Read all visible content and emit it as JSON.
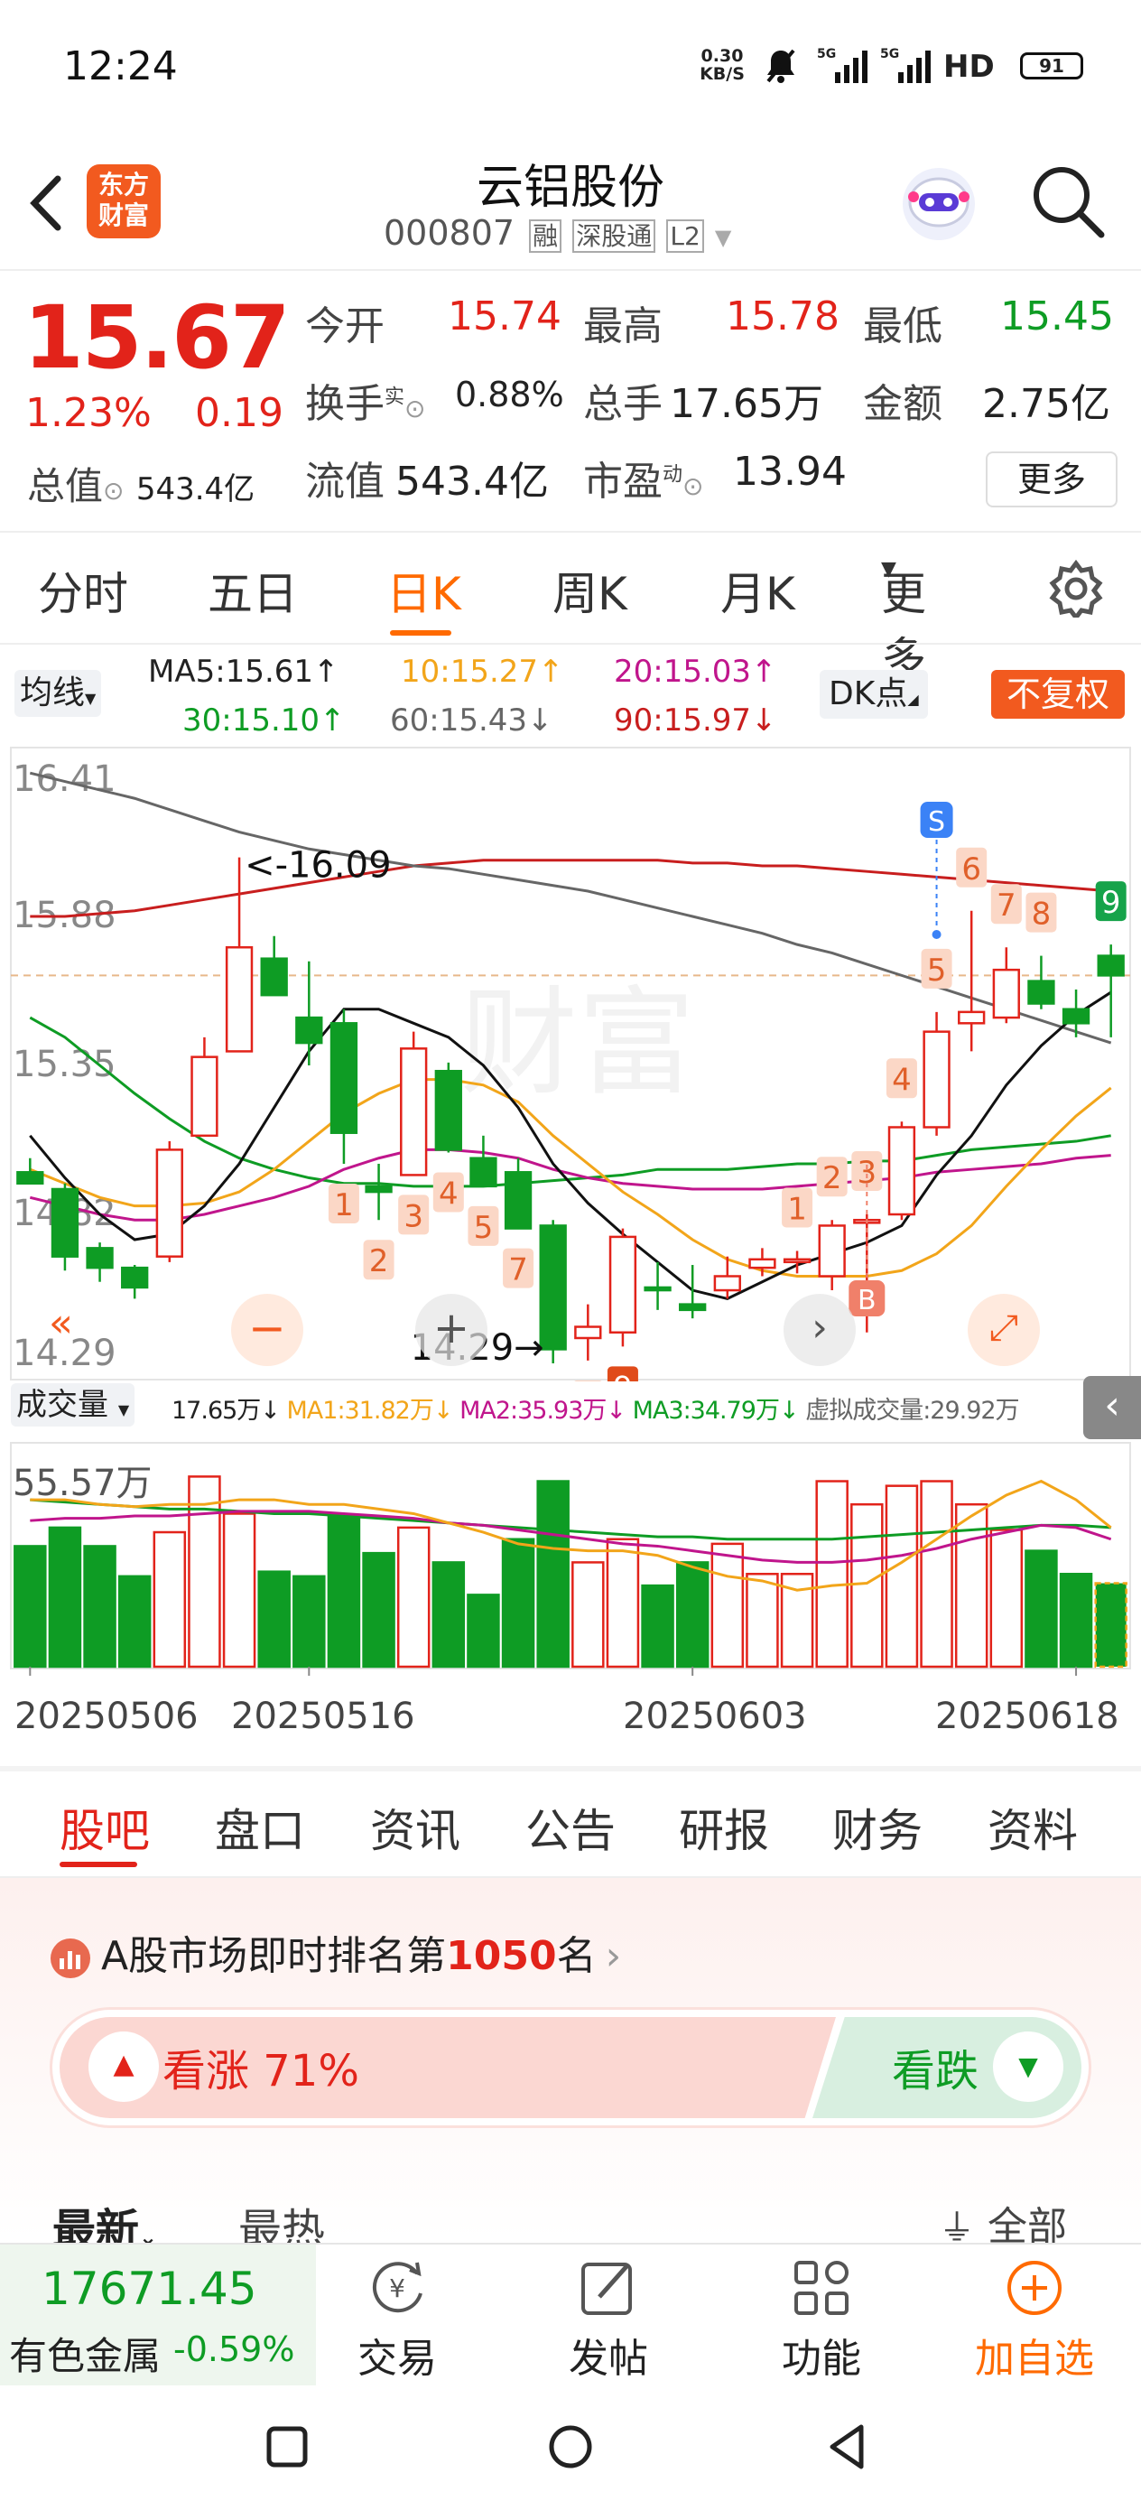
{
  "status": {
    "time": "12:24",
    "net_speed_top": "0.30",
    "net_speed_bottom": "KB/S",
    "sig1": "5G",
    "sig2": "5G",
    "hd": "HD",
    "battery": "91"
  },
  "header": {
    "logo_top": "东方",
    "logo_bottom": "财富",
    "title": "云铝股份",
    "code": "000807",
    "tags": [
      "融",
      "深股通",
      "L2"
    ]
  },
  "quote": {
    "price": "15.67",
    "pct": "1.23%",
    "chg": "0.19",
    "fields": {
      "open_l": "今开",
      "open_v": "15.74",
      "high_l": "最高",
      "high_v": "15.78",
      "low_l": "最低",
      "low_v": "15.45",
      "turn_l": "换手",
      "turn_sup": "实",
      "turn_v": "0.88%",
      "vol_l": "总手",
      "vol_v": "17.65万",
      "amt_l": "金额",
      "amt_v": "2.75亿",
      "mcap_l": "总值",
      "mcap_v": "543.4亿",
      "float_l": "流值",
      "float_v": "543.4亿",
      "pe_l": "市盈",
      "pe_sup": "动",
      "pe_v": "13.94"
    },
    "more": "更多"
  },
  "period_tabs": [
    "分时",
    "五日",
    "日K",
    "周K",
    "月K",
    "更多"
  ],
  "ma": {
    "selector": "均线",
    "ma5": "MA5:15.61↑",
    "ma10": "10:15.27↑",
    "ma20": "20:15.03↑",
    "ma30": "30:15.10↑",
    "ma60": "60:15.43↓",
    "ma90": "90:15.97↓",
    "dk": "DK点",
    "fq": "不复权"
  },
  "chart": {
    "y_labels": [
      "16.41",
      "15.88",
      "15.35",
      "14.82",
      "14.29"
    ],
    "hi_label": "<-16.09",
    "lo_label": "14.29→",
    "s_mark": "S",
    "b_mark": "B"
  },
  "volume": {
    "selector": "成交量",
    "vol": "17.65万↓",
    "ma1": "MA1:31.82万↓",
    "ma2": "MA2:35.93万↓",
    "ma3": "MA3:34.79万↓",
    "virtual": "虚拟成交量:29.92万",
    "y_label": "55.57万",
    "dates": [
      "20250506",
      "20250516",
      "20250603",
      "20250618"
    ]
  },
  "bottom_tabs": [
    "股吧",
    "盘口",
    "资讯",
    "公告",
    "研报",
    "财务",
    "资料"
  ],
  "rank": {
    "prefix": "A股市场即时排名第",
    "num": "1050",
    "suffix": "名"
  },
  "sentiment": {
    "up": "看涨 71%",
    "down": "看跌"
  },
  "feed": {
    "latest": "最新",
    "hot": "最热",
    "all": "全部"
  },
  "bottombar": {
    "index_value": "17671.45",
    "index_name": "有色金属",
    "index_pct": "-0.59%",
    "trade": "交易",
    "post": "发帖",
    "func": "功能",
    "add": "加自选"
  },
  "colors": {
    "red": "#e2231a",
    "green": "#0e9c24",
    "accent": "#ff6a00"
  },
  "chart_data": {
    "type": "candlestick",
    "candles": [
      {
        "o": 14.97,
        "h": 15.02,
        "l": 14.93,
        "c": 14.93
      },
      {
        "o": 14.91,
        "h": 14.93,
        "l": 14.62,
        "c": 14.67
      },
      {
        "o": 14.7,
        "h": 14.72,
        "l": 14.58,
        "c": 14.63
      },
      {
        "o": 14.63,
        "h": 14.64,
        "l": 14.52,
        "c": 14.56
      },
      {
        "o": 14.67,
        "h": 15.08,
        "l": 14.65,
        "c": 15.05
      },
      {
        "o": 15.1,
        "h": 15.45,
        "l": 15.1,
        "c": 15.38
      },
      {
        "o": 15.4,
        "h": 16.09,
        "l": 15.4,
        "c": 15.77
      },
      {
        "o": 15.73,
        "h": 15.81,
        "l": 15.6,
        "c": 15.6
      },
      {
        "o": 15.52,
        "h": 15.72,
        "l": 15.35,
        "c": 15.43
      },
      {
        "o": 15.5,
        "h": 15.55,
        "l": 15.0,
        "c": 15.11
      },
      {
        "o": 14.92,
        "h": 15.0,
        "l": 14.8,
        "c": 14.9
      },
      {
        "o": 14.96,
        "h": 15.47,
        "l": 14.96,
        "c": 15.41
      },
      {
        "o": 15.33,
        "h": 15.36,
        "l": 15.04,
        "c": 15.05
      },
      {
        "o": 15.02,
        "h": 15.1,
        "l": 14.92,
        "c": 14.92
      },
      {
        "o": 14.97,
        "h": 15.02,
        "l": 14.77,
        "c": 14.77
      },
      {
        "o": 14.78,
        "h": 14.8,
        "l": 14.29,
        "c": 14.34
      },
      {
        "o": 14.38,
        "h": 14.5,
        "l": 14.3,
        "c": 14.42
      },
      {
        "o": 14.4,
        "h": 14.77,
        "l": 14.35,
        "c": 14.74
      },
      {
        "o": 14.56,
        "h": 14.65,
        "l": 14.48,
        "c": 14.55
      },
      {
        "o": 14.5,
        "h": 14.64,
        "l": 14.45,
        "c": 14.48
      },
      {
        "o": 14.55,
        "h": 14.67,
        "l": 14.52,
        "c": 14.6
      },
      {
        "o": 14.63,
        "h": 14.7,
        "l": 14.6,
        "c": 14.66
      },
      {
        "o": 14.66,
        "h": 14.69,
        "l": 14.61,
        "c": 14.66
      },
      {
        "o": 14.6,
        "h": 14.8,
        "l": 14.55,
        "c": 14.78
      },
      {
        "o": 14.79,
        "h": 14.82,
        "l": 14.4,
        "c": 14.8
      },
      {
        "o": 14.82,
        "h": 15.15,
        "l": 14.8,
        "c": 15.13
      },
      {
        "o": 15.13,
        "h": 15.54,
        "l": 15.1,
        "c": 15.47
      },
      {
        "o": 15.5,
        "h": 15.9,
        "l": 15.4,
        "c": 15.54
      },
      {
        "o": 15.52,
        "h": 15.77,
        "l": 15.5,
        "c": 15.69
      },
      {
        "o": 15.65,
        "h": 15.74,
        "l": 15.55,
        "c": 15.57
      },
      {
        "o": 15.55,
        "h": 15.62,
        "l": 15.45,
        "c": 15.5
      },
      {
        "o": 15.74,
        "h": 15.78,
        "l": 15.45,
        "c": 15.67
      }
    ],
    "volume": [
      52,
      60,
      52,
      39,
      58,
      82,
      66,
      41,
      39,
      65,
      49,
      60,
      45,
      31,
      55,
      80,
      45,
      55,
      35,
      45,
      53,
      40,
      40,
      80,
      70,
      78,
      80,
      70,
      59,
      50,
      40,
      36
    ],
    "ma5": [
      15.1,
      14.95,
      14.82,
      14.73,
      14.75,
      14.85,
      15.0,
      15.2,
      15.4,
      15.55,
      15.55,
      15.5,
      15.45,
      15.35,
      15.2,
      15.0,
      14.86,
      14.75,
      14.65,
      14.55,
      14.52,
      14.58,
      14.64,
      14.68,
      14.72,
      14.78,
      14.96,
      15.1,
      15.28,
      15.42,
      15.53,
      15.61
    ],
    "ma10": [
      14.98,
      14.93,
      14.88,
      14.85,
      14.85,
      14.86,
      14.9,
      14.98,
      15.08,
      15.18,
      15.25,
      15.3,
      15.3,
      15.28,
      15.22,
      15.1,
      15.0,
      14.9,
      14.82,
      14.73,
      14.66,
      14.62,
      14.6,
      14.6,
      14.6,
      14.62,
      14.68,
      14.78,
      14.92,
      15.05,
      15.17,
      15.27
    ],
    "ma20": [
      14.88,
      14.85,
      14.82,
      14.8,
      14.8,
      14.82,
      14.85,
      14.88,
      14.92,
      14.98,
      15.02,
      15.05,
      15.05,
      15.04,
      15.02,
      14.98,
      14.95,
      14.93,
      14.92,
      14.91,
      14.91,
      14.91,
      14.92,
      14.93,
      14.94,
      14.95,
      14.97,
      14.98,
      14.99,
      15.0,
      15.02,
      15.03
    ],
    "ma30": [
      15.52,
      15.45,
      15.35,
      15.25,
      15.16,
      15.08,
      15.02,
      14.98,
      14.95,
      14.93,
      14.93,
      14.92,
      14.92,
      14.92,
      14.93,
      14.94,
      14.95,
      14.96,
      14.98,
      14.98,
      14.98,
      14.99,
      15.0,
      15.0,
      15.01,
      15.01,
      15.03,
      15.05,
      15.06,
      15.07,
      15.08,
      15.1
    ],
    "ma60": [
      16.39,
      16.36,
      16.33,
      16.3,
      16.26,
      16.22,
      16.18,
      16.15,
      16.12,
      16.1,
      16.08,
      16.06,
      16.05,
      16.03,
      16.01,
      15.99,
      15.97,
      15.94,
      15.91,
      15.88,
      15.85,
      15.82,
      15.78,
      15.75,
      15.71,
      15.67,
      15.63,
      15.59,
      15.55,
      15.51,
      15.47,
      15.43
    ],
    "ma90": [
      15.88,
      15.88,
      15.89,
      15.9,
      15.92,
      15.94,
      15.96,
      15.98,
      16.0,
      16.02,
      16.04,
      16.06,
      16.07,
      16.08,
      16.08,
      16.08,
      16.08,
      16.08,
      16.08,
      16.07,
      16.07,
      16.06,
      16.06,
      16.05,
      16.04,
      16.03,
      16.02,
      16.01,
      16.0,
      15.99,
      15.98,
      15.97
    ],
    "vol_ma1": [
      72,
      72,
      70,
      69,
      70,
      70,
      72,
      72,
      70,
      70,
      68,
      66,
      62,
      58,
      53,
      51,
      50,
      50,
      48,
      43,
      39,
      37,
      33,
      35,
      36,
      45,
      55,
      65,
      74,
      80,
      72,
      60
    ],
    "vol_ma2": [
      63,
      64,
      64,
      65,
      65,
      66,
      67,
      67,
      67,
      66,
      65,
      64,
      62,
      61,
      59,
      57,
      55,
      53,
      52,
      50,
      48,
      46,
      45,
      45,
      46,
      48,
      51,
      55,
      58,
      61,
      60,
      55
    ],
    "vol_ma3": [
      72,
      71,
      70,
      69,
      68,
      68,
      67,
      66,
      66,
      65,
      64,
      63,
      62,
      61,
      60,
      59,
      58,
      57,
      56,
      56,
      55,
      55,
      55,
      55,
      56,
      57,
      58,
      59,
      60,
      61,
      61,
      60
    ],
    "y_range": [
      14.29,
      16.41
    ],
    "vol_max": 95,
    "counts": [
      {
        "i": 9,
        "n": "1",
        "pos": "below"
      },
      {
        "i": 10,
        "n": "2",
        "pos": "below"
      },
      {
        "i": 11,
        "n": "3",
        "pos": "below"
      },
      {
        "i": 12,
        "n": "4",
        "pos": "below"
      },
      {
        "i": 13,
        "n": "5",
        "pos": "below"
      },
      {
        "i": 14,
        "n": "7",
        "pos": "below"
      },
      {
        "i": 15,
        "n": "6",
        "pos": "below"
      },
      {
        "i": 16,
        "n": "8",
        "pos": "below"
      },
      {
        "i": 17,
        "n": "9",
        "pos": "below"
      },
      {
        "i": 22,
        "n": "1",
        "pos": "above"
      },
      {
        "i": 23,
        "n": "2",
        "pos": "above"
      },
      {
        "i": 24,
        "n": "3",
        "pos": "above"
      },
      {
        "i": 25,
        "n": "4",
        "pos": "above"
      },
      {
        "i": 26,
        "n": "5",
        "pos": "above"
      },
      {
        "i": 27,
        "n": "6",
        "pos": "above"
      },
      {
        "i": 28,
        "n": "7",
        "pos": "above"
      },
      {
        "i": 29,
        "n": "8",
        "pos": "above"
      },
      {
        "i": 31,
        "n": "9",
        "pos": "above"
      }
    ]
  }
}
